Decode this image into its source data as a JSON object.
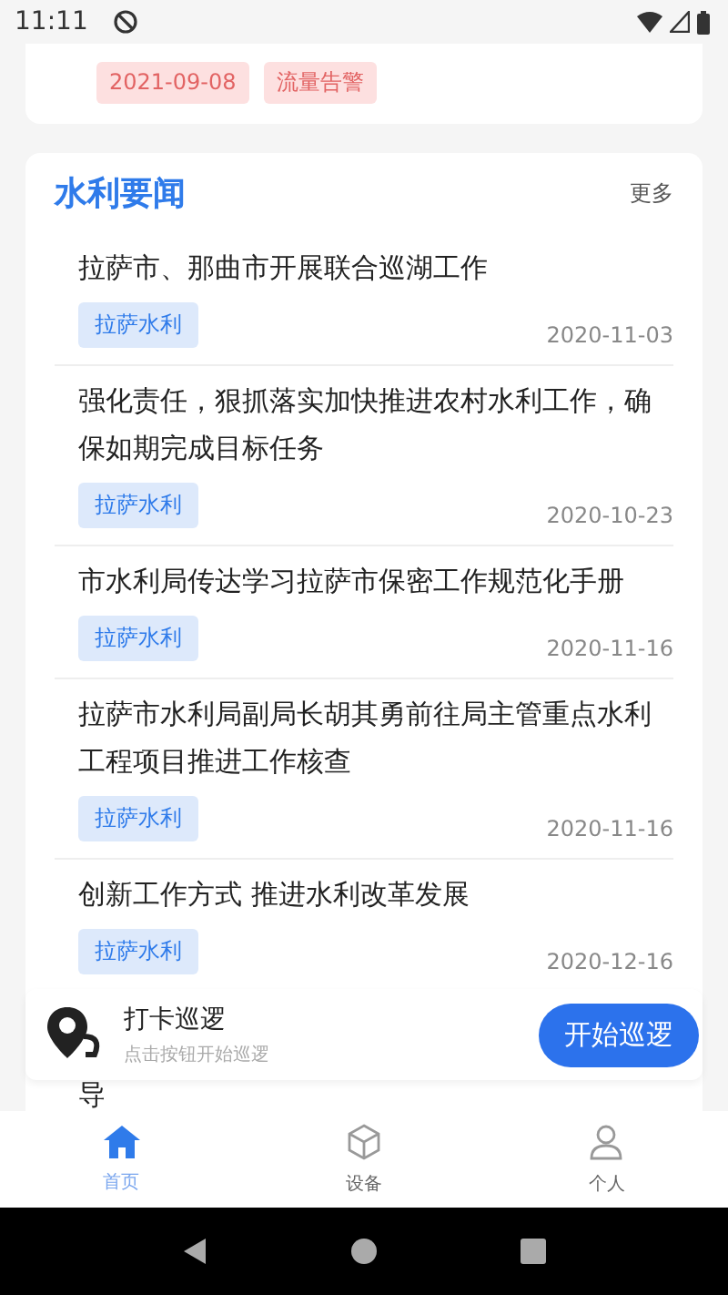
{
  "status_bar": {
    "time": "11:11"
  },
  "alert_card": {
    "tags": [
      {
        "text": "2021-09-08"
      },
      {
        "text": "流量告警"
      }
    ]
  },
  "news": {
    "title": "水利要闻",
    "more": "更多",
    "items": [
      {
        "title": "拉萨市、那曲市开展联合巡湖工作",
        "tag": "拉萨水利",
        "date": "2020-11-03"
      },
      {
        "title": "强化责任，狠抓落实加快推进农村水利工作，确保如期完成目标任务",
        "tag": "拉萨水利",
        "date": "2020-10-23"
      },
      {
        "title": "市水利局传达学习拉萨市保密工作规范化手册",
        "tag": "拉萨水利",
        "date": "2020-11-16"
      },
      {
        "title": "拉萨市水利局副局长胡其勇前往局主管重点水利工程项目推进工作核查",
        "tag": "拉萨水利",
        "date": "2020-11-16"
      },
      {
        "title": "创新工作方式 推进水利改革发展",
        "tag": "拉萨水利",
        "date": "2020-12-16"
      }
    ],
    "partial_title": "导"
  },
  "patrol": {
    "title": "打卡巡逻",
    "subtitle": "点击按钮开始巡逻",
    "button": "开始巡逻"
  },
  "nav": [
    {
      "label": "首页",
      "selected": true,
      "kind": "home"
    },
    {
      "label": "设备",
      "selected": false,
      "kind": "device"
    },
    {
      "label": "个人",
      "selected": false,
      "kind": "person"
    }
  ]
}
